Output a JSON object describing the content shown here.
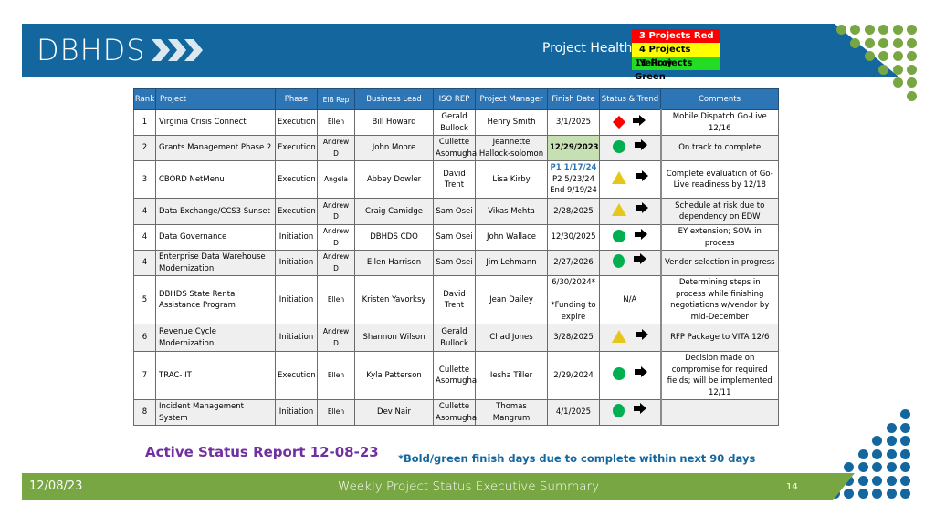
{
  "header": {
    "logo_text": "DBHDS",
    "health_label": "Project Health",
    "health_counts": {
      "red": "3  Projects Red",
      "yellow": "4  Projects Yellow",
      "green": "11  Projects Green"
    }
  },
  "table": {
    "columns": [
      "Rank",
      "Project",
      "Phase",
      "EIB Rep",
      "Business Lead",
      "ISO REP",
      "Project Manager",
      "Finish Date",
      "Status & Trend",
      "Comments"
    ],
    "rows": [
      {
        "rank": "1",
        "project": "Virginia Crisis Connect",
        "phase": "Execution",
        "eib": "Ellen",
        "lead": "Bill Howard",
        "iso": "Gerald Bullock",
        "pm": "Henry Smith",
        "finish": "3/1/2025",
        "status": "red-diamond",
        "trend": "right-arrow",
        "comments": "Mobile Dispatch Go-Live 12/16"
      },
      {
        "rank": "2",
        "project": "Grants Management Phase 2",
        "phase": "Execution",
        "eib": "Andrew D",
        "lead": "John Moore",
        "iso": "Cullette Asomugha",
        "pm": "Jeannette Hallock-solomon",
        "finish": "12/29/2023",
        "status": "green-circle",
        "trend": "right-arrow",
        "comments": "On track to complete"
      },
      {
        "rank": "3",
        "project": "CBORD NetMenu",
        "phase": "Execution",
        "eib": "Angela",
        "lead": "Abbey Dowler",
        "iso": "David Trent",
        "pm": "Lisa Kirby",
        "finish_lines": [
          "P1 1/17/24",
          "P2 5/23/24",
          "End 9/19/24"
        ],
        "status": "yellow-triangle",
        "trend": "right-arrow",
        "comments": "Complete evaluation of Go-Live readiness by 12/18"
      },
      {
        "rank": "4",
        "project": "Data Exchange/CCS3 Sunset",
        "phase": "Execution",
        "eib": "Andrew D",
        "lead": "Craig Camidge",
        "iso": "Sam Osei",
        "pm": "Vikas Mehta",
        "finish": "2/28/2025",
        "status": "yellow-triangle",
        "trend": "right-arrow",
        "comments": "Schedule at risk due to dependency on EDW"
      },
      {
        "rank": "4",
        "project": "Data Governance",
        "phase": "Initiation",
        "eib": "Andrew D",
        "lead": "DBHDS CDO",
        "iso": "Sam Osei",
        "pm": "John Wallace",
        "finish": "12/30/2025",
        "status": "green-circle",
        "trend": "right-arrow",
        "comments": "EY extension; SOW in process"
      },
      {
        "rank": "4",
        "project": "Enterprise Data Warehouse Modernization",
        "phase": "Initiation",
        "eib": "Andrew D",
        "lead": "Ellen Harrison",
        "iso": "Sam Osei",
        "pm": "Jim Lehmann",
        "finish": "2/27/2026",
        "status": "green-circle",
        "trend": "right-arrow",
        "comments": "Vendor selection in progress"
      },
      {
        "rank": "5",
        "project": "DBHDS State Rental Assistance Program",
        "phase": "Initiation",
        "eib": "Ellen",
        "lead": "Kristen Yavorksy",
        "iso": "David Trent",
        "pm": "Jean Dailey",
        "finish_lines": [
          "6/30/2024*",
          "",
          "*Funding to expire"
        ],
        "status_text": "N/A",
        "comments": "Determining steps in process while finishing negotiations w/vendor by mid-December"
      },
      {
        "rank": "6",
        "project": "Revenue Cycle Modernization",
        "phase": "Initiation",
        "eib": "Andrew D",
        "lead": "Shannon Wilson",
        "iso": "Gerald Bullock",
        "pm": "Chad Jones",
        "finish": "3/28/2025",
        "status": "yellow-triangle",
        "trend": "right-arrow",
        "comments": "RFP Package to VITA 12/6"
      },
      {
        "rank": "7",
        "project": "TRAC- IT",
        "phase": "Execution",
        "eib": "Ellen",
        "lead": "Kyla Patterson",
        "iso": "Cullette Asomugha",
        "pm": "Iesha Tiller",
        "finish": "2/29/2024",
        "status": "green-circle",
        "trend": "right-arrow",
        "comments": "Decision made on compromise for required fields; will be implemented 12/11"
      },
      {
        "rank": "8",
        "project": "Incident Management System",
        "phase": "Initiation",
        "eib": "Ellen",
        "lead": "Dev Nair",
        "iso": "Cullette Asomugha",
        "pm": "Thomas Mangrum",
        "finish": "4/1/2025",
        "status": "green-circle",
        "trend": "right-arrow",
        "comments": ""
      }
    ]
  },
  "bottom": {
    "report_link": "Active Status Report 12-08-23",
    "footnote": "*Bold/green finish days due to complete within next 90 days"
  },
  "footer": {
    "date": "12/08/23",
    "title": "Weekly Project Status Executive Summary",
    "page": "14"
  },
  "colors": {
    "brand_blue": "#14679e",
    "brand_green": "#78a642",
    "header_blue": "#2e75b6",
    "status_red": "#ff0000",
    "status_yellow": "#e6c619",
    "status_green": "#00b050"
  }
}
